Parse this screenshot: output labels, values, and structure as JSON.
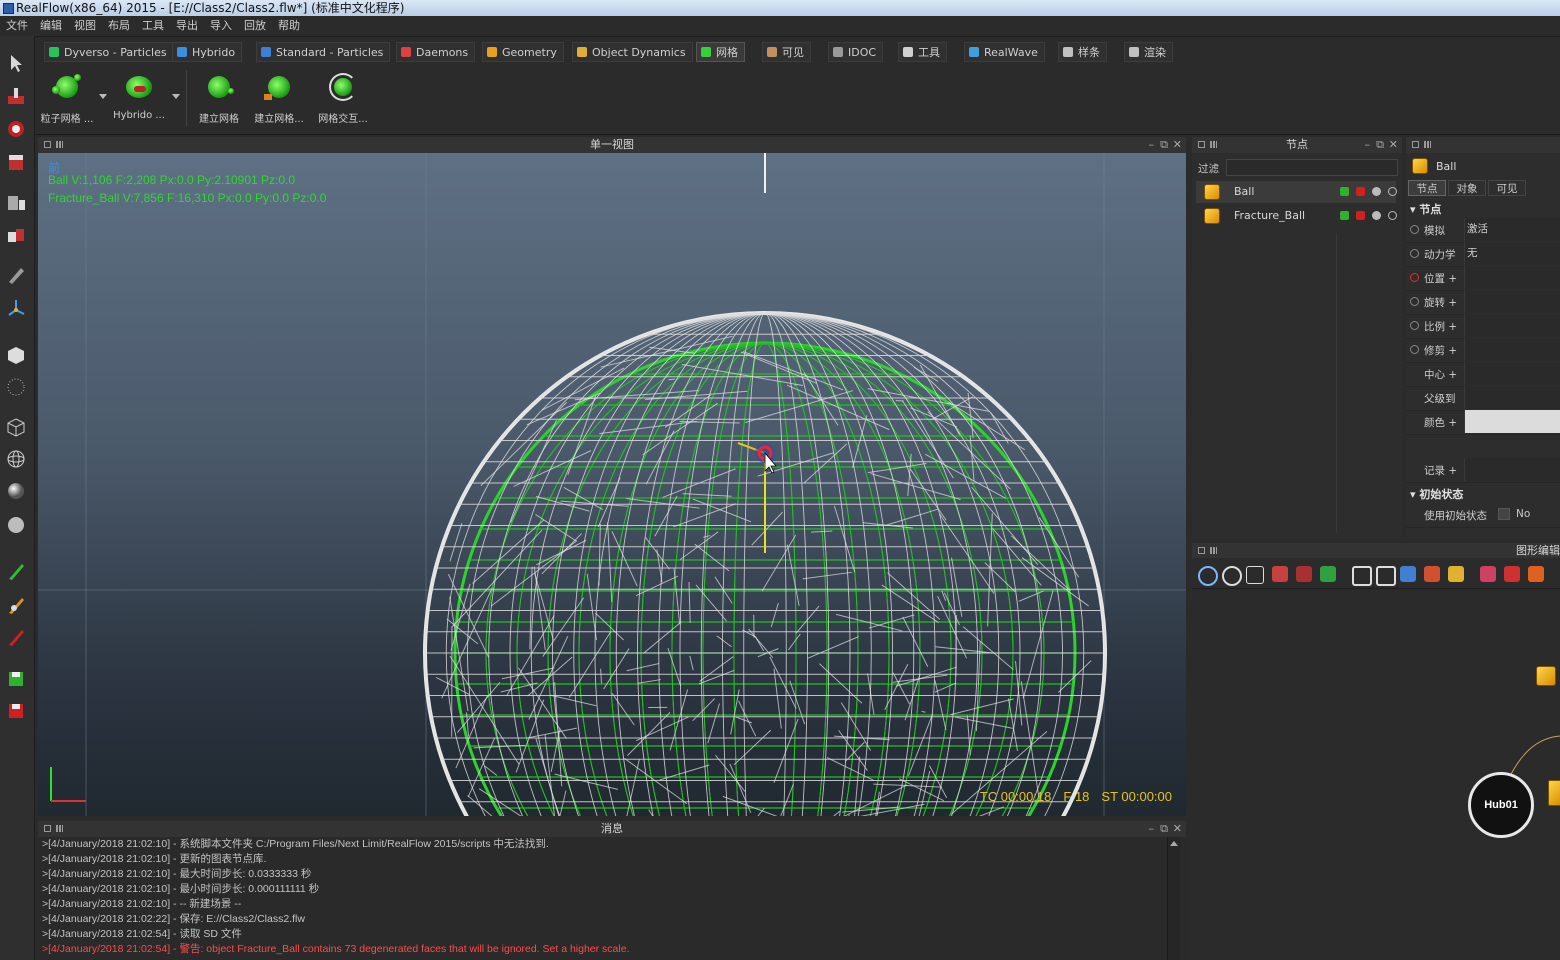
{
  "window": {
    "title": "RealFlow(x86_64) 2015 - [E://Class2/Class2.flw*] (标准中文化程序)"
  },
  "menu": [
    "文件",
    "编辑",
    "视图",
    "布局",
    "工具",
    "导出",
    "导入",
    "回放",
    "帮助"
  ],
  "shelf_tabs": [
    {
      "label": "Dyverso - Particles",
      "color": "#27c35a"
    },
    {
      "label": "Hybrido",
      "color": "#3a8fe0"
    },
    {
      "label": "Standard - Particles",
      "color": "#3c7fd6"
    },
    {
      "label": "Daemons",
      "color": "#e04040"
    },
    {
      "label": "Geometry",
      "color": "#e8a020"
    },
    {
      "label": "Object Dynamics",
      "color": "#e0b030"
    },
    {
      "label": "网格",
      "color": "#3ad03a"
    },
    {
      "label": "可见",
      "color": "#c09060"
    },
    {
      "label": "IDOC",
      "color": "#9a9a9a"
    },
    {
      "label": "工具",
      "color": "#d0d0d0"
    },
    {
      "label": "RealWave",
      "color": "#3aa0e0"
    },
    {
      "label": "样条",
      "color": "#c0c0c0"
    },
    {
      "label": "渲染",
      "color": "#c0c0c0"
    }
  ],
  "shelf_buttons": [
    "粒子网格 ...",
    "Hybrido ...",
    "建立网格",
    "建立网格...",
    "网格交互..."
  ],
  "viewport": {
    "title": "单一视图",
    "view_label": "前",
    "hud_lines": [
      "Ball V:1,106 F:2,208 Px:0.0 Py:2.10901 Pz:0.0",
      "Fracture_Ball V:7,856 F:16,310 Px:0.0 Py:0.0 Pz:0.0"
    ],
    "timecode": "TC 00:00:18",
    "frame": "F 18",
    "sim_time": "ST 00:00:00"
  },
  "messages": {
    "title": "消息",
    "lines": [
      {
        "text": ">[4/January/2018 21:02:10] - 系统脚本文件夹 C:/Program Files/Next Limit/RealFlow 2015/scripts 中无法找到.",
        "warn": false
      },
      {
        "text": ">[4/January/2018 21:02:10] - 更新的图表节点库.",
        "warn": false
      },
      {
        "text": ">[4/January/2018 21:02:10] - 最大时间步长: 0.0333333 秒",
        "warn": false
      },
      {
        "text": ">[4/January/2018 21:02:10] - 最小时间步长: 0.000111111 秒",
        "warn": false
      },
      {
        "text": ">[4/January/2018 21:02:10] - -- 新建场景 --",
        "warn": false
      },
      {
        "text": ">[4/January/2018 21:02:22] - 保存: E://Class2/Class2.flw",
        "warn": false
      },
      {
        "text": ">[4/January/2018 21:02:54] - 读取 SD 文件",
        "warn": false
      },
      {
        "text": ">[4/January/2018 21:02:54] - 警告: object Fracture_Ball contains 73 degenerated faces that will be ignored. Set a higher scale.",
        "warn": true
      }
    ]
  },
  "nodes_panel": {
    "title": "节点",
    "filter_label": "过滤",
    "items": [
      {
        "name": "Ball",
        "selected": true
      },
      {
        "name": "Fracture_Ball",
        "selected": false
      }
    ]
  },
  "params_panel": {
    "object_name": "Ball",
    "tabs": [
      "节点",
      "对象",
      "可见"
    ],
    "section_node": "节点",
    "rows": [
      {
        "label": "模拟",
        "value": "激活"
      },
      {
        "label": "动力学",
        "value": "无"
      },
      {
        "label": "位置 +",
        "value": ""
      },
      {
        "label": "旋转 +",
        "value": ""
      },
      {
        "label": "比例 +",
        "value": ""
      },
      {
        "label": "修剪 +",
        "value": ""
      },
      {
        "label": "中心 +",
        "value": ""
      },
      {
        "label": "父级到",
        "value": ""
      },
      {
        "label": "颜色 +",
        "value": ""
      },
      {
        "label": "记录 +",
        "value": ""
      }
    ],
    "section_initial": "初始状态",
    "use_initial_label": "使用初始状态",
    "use_initial_value": "No"
  },
  "graph_editor": {
    "title": "图形编辑",
    "hub_label": "Hub01"
  }
}
